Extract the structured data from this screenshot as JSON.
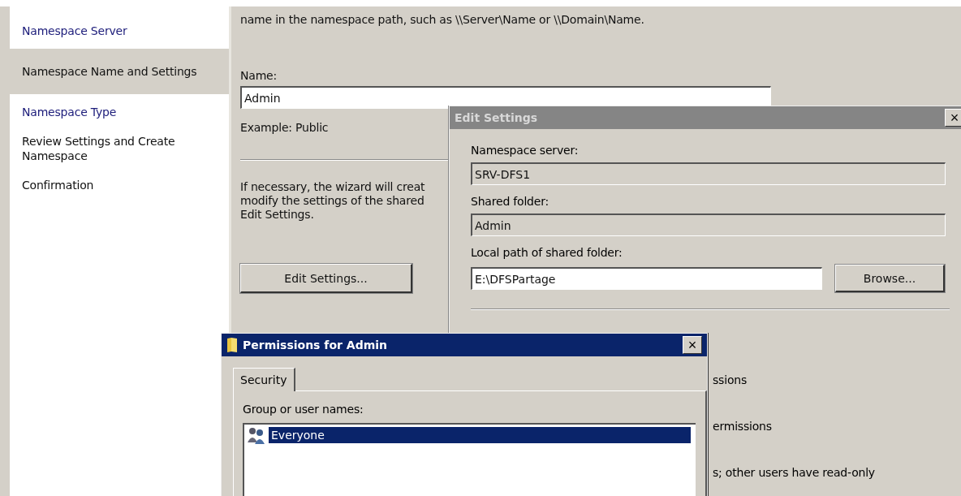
{
  "sidebar": {
    "items": [
      {
        "label": "Namespace Server",
        "selected": false,
        "link": true
      },
      {
        "label": "Namespace Name and Settings",
        "selected": true,
        "link": false
      },
      {
        "label": "Namespace Type",
        "selected": false,
        "link": true
      },
      {
        "label": "Review Settings and Create Namespace",
        "selected": false,
        "link": false
      },
      {
        "label": "Confirmation",
        "selected": false,
        "link": false
      }
    ]
  },
  "page": {
    "intro": "name in the namespace path, such as \\\\Server\\Name or \\\\Domain\\Name.",
    "name_label": "Name:",
    "name_value": "Admin",
    "example": "Example: Public",
    "note": "If necessary, the wizard will creat\nmodify the settings of the shared\nEdit Settings.",
    "edit_button": "Edit Settings..."
  },
  "edit_settings": {
    "title": "Edit Settings",
    "close": "×",
    "server_label": "Namespace server:",
    "server_value": "SRV-DFS1",
    "folder_label": "Shared folder:",
    "folder_value": "Admin",
    "path_label": "Local path of shared folder:",
    "path_value": "E:\\DFSPartage",
    "browse_button": "Browse...",
    "fragments": [
      "ssions",
      "ermissions",
      "s; other users have read-only"
    ]
  },
  "permissions": {
    "title": "Permissions for Admin",
    "close": "×",
    "tabs": [
      {
        "label": "Security",
        "selected": true
      }
    ],
    "group_label": "Group or user names:",
    "users": [
      {
        "name": "Everyone",
        "selected": true
      }
    ]
  }
}
